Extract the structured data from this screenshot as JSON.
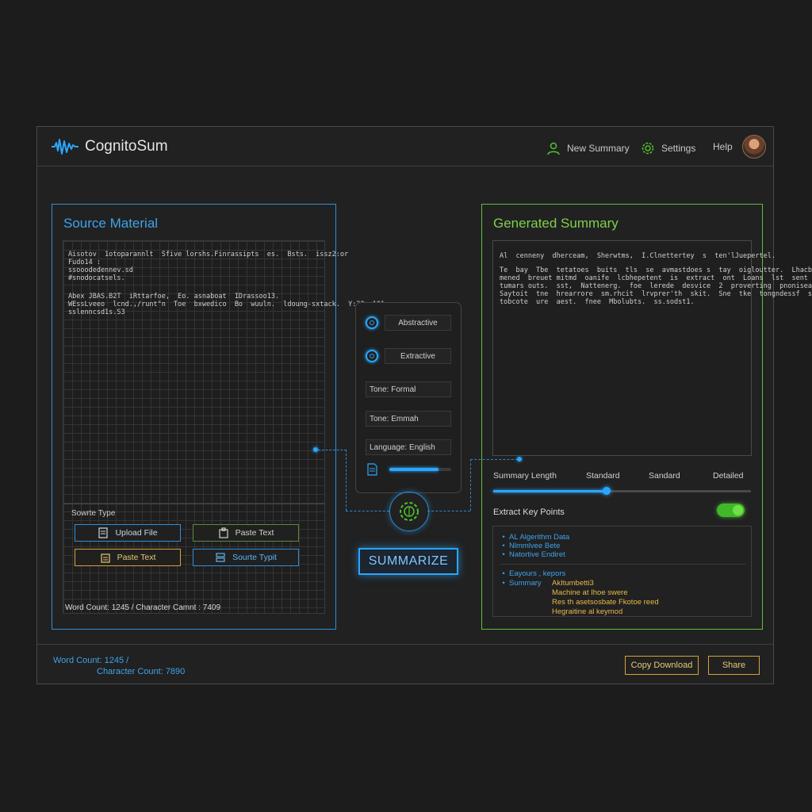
{
  "app": {
    "title": "CognitoSum"
  },
  "nav": {
    "new_summary": "New Summary",
    "settings": "Settings",
    "help": "Help"
  },
  "source": {
    "title": "Source Material",
    "text_lines": [
      "Aisotov  1otoparannlt  Sfive lorshs.Finrassipts  es.  Bsts.  issz2:or",
      "Fudo14 :",
      "ssooodedennev.sd",
      "#snodocatsels.",
      "",
      "Abex JBAS.B2T  iRttarfoe,  Eo. asnaboat  IDrassoo13.",
      "WEssLveeo  lcnd.,/runt\"n  Toe  bxwedico  Bo  wuuln.  ldoung-sxtack.  Y:22  101",
      "sslenncsd1s.S3"
    ],
    "source_type_label": "Sowrte Type",
    "buttons": {
      "upload_file": "Upload File",
      "paste_text_1": "Paste Text",
      "paste_text_2": "Paste Text",
      "source_type": "Sourte Typit"
    },
    "stats": "Word Count: 1245 / Character Camnt : 7409"
  },
  "options": {
    "abstractive": "Abstractive",
    "extractive": "Extractive",
    "tone_formal": "Tone: Formal",
    "tone_other": "Tone: Emmah",
    "language": "Language: English",
    "progress": 0.8
  },
  "summarize_label": "SUMMARIZE",
  "summary": {
    "title": "Generated Summary",
    "text_lines": [
      "Al  cenneny  dherceam,  Sherwtms,  I.Clnettertey  s  ten'lJuepertel.",
      "",
      "Te  bay  Tbe  tetatoes  buits  tls  se  avmastdoes s  tay  oigloutter.  Lhacbeme",
      "mened  breuet mitmd  oanife  lcbhepetent  is  extract  ont  Loans  lst  sent",
      "tumars outs.  sst,  Nattenerg.  foe  lerede  desvice  2  proverting  pnoniseane",
      "Saytoit  tne  hrearrore  sm.rhcit  lrvprer'th  skit.  Sne  tke  tongndessf  sete",
      "tobcote  ure  aest.  fnee  Mbolubts.  ss.sodst1."
    ],
    "length_label": "Summary Length",
    "length_options": [
      "Standard",
      "Sandard",
      "Detailed"
    ],
    "length_value": 0.44,
    "key_points_label": "Extract Key Points",
    "key_points_on": true,
    "key_points_top": [
      "AL Algerithm Data",
      "Nlmmlvee Bete",
      "Natortive Endiret"
    ],
    "key_points_bottom_left": [
      "Eayours  ,  kepors",
      "Summary"
    ],
    "key_points_bottom_right": [
      "AkItumbetti3",
      "Machine  at  Ihoe  swere",
      "Res  th  asetsosbate  Fkotoe  reed",
      "Hegraitine  al  keymod"
    ]
  },
  "footer": {
    "word_count": "Word Count: 1245 /",
    "char_count": "Character Count: 7890",
    "copy_download": "Copy Download",
    "share": "Share"
  },
  "colors": {
    "accent_blue": "#2aa6ff",
    "accent_green": "#5fbf3a",
    "accent_orange": "#d6a23a",
    "background": "#1c1c1c"
  }
}
